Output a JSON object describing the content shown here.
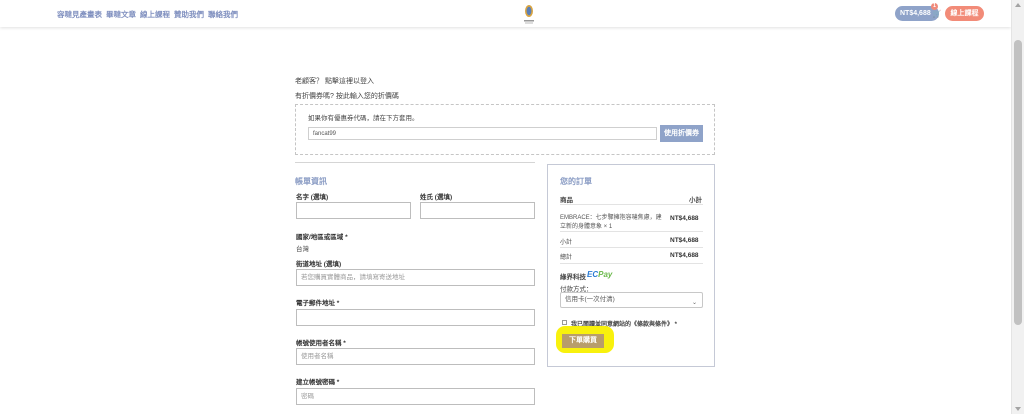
{
  "header": {
    "nav": [
      "容噠見產畫表",
      "畢噠文章",
      "線上課程",
      "贊助我們",
      "聯絡我們"
    ],
    "cart_amount": "NT$4,688",
    "cart_count": "1",
    "login_label": "線上課程"
  },
  "returning_customer": "老顧客？ 點擊這裡以登入",
  "coupon_prompt": "有折價券嗎? 按此輸入您的折價碼",
  "coupon": {
    "instruction": "如果你有優惠券代碼，請在下方套用。",
    "input_value": "fancat99",
    "apply_label": "使用折價券"
  },
  "billing": {
    "title": "帳單資訊",
    "first_name_label": "名字 (選填)",
    "last_name_label": "姓氏 (選填)",
    "country_label": "國家/地區或區域 *",
    "country_value": "台灣",
    "street_label": "街道地址 (選填)",
    "street_placeholder": "若您購買實體商品，請填寫寄送地址",
    "email_label": "電子郵件地址 *",
    "username_label": "帳號使用者名稱 *",
    "username_placeholder": "使用者名稱",
    "password_label": "建立帳號密碼 *",
    "password_placeholder": "密碼"
  },
  "order": {
    "title": "您的訂單",
    "col_product": "商品",
    "col_subtotal": "小計",
    "item_line1": "EMBRACE：七步驟擁抱容噠焦慮，建",
    "item_line2": "立新的身體意象  × 1",
    "item_price": "NT$4,688",
    "subtotal_label": "小計",
    "subtotal_value": "NT$4,688",
    "total_label": "總計",
    "total_value": "NT$4,688",
    "payment_provider": "綠界科技",
    "ecpay_brand_ec": "EC",
    "ecpay_brand_pay": "Pay",
    "payment_method_label": "付款方式：",
    "payment_method_value": "信用卡(一次付清)",
    "terms_label": "我已閱讀並同意網站的《條款與條件》 *",
    "submit_label": "下單購買"
  }
}
